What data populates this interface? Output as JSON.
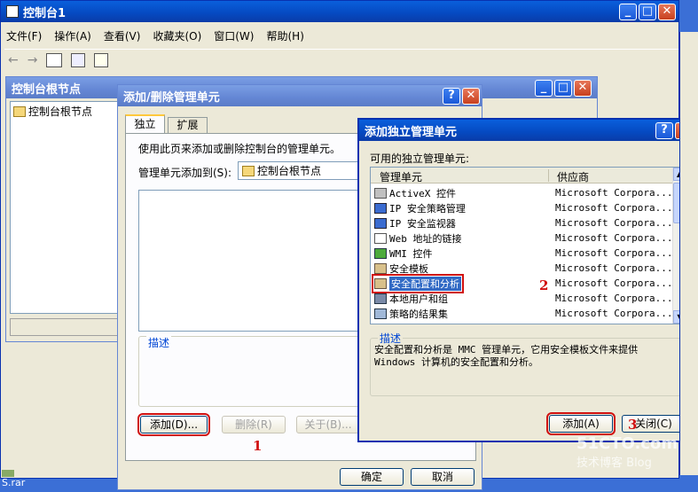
{
  "main_window": {
    "title": "控制台1",
    "menu": [
      "文件(F)",
      "操作(A)",
      "查看(V)",
      "收藏夹(O)",
      "窗口(W)",
      "帮助(H)"
    ]
  },
  "console_root": {
    "title": "控制台根节点",
    "tree_item": "控制台根节点"
  },
  "add_remove_dialog": {
    "title": "添加/删除管理单元",
    "tabs": [
      "独立",
      "扩展"
    ],
    "instruction": "使用此页来添加或删除控制台的管理单元。",
    "add_to_label": "管理单元添加到(S):",
    "add_to_value": "控制台根节点",
    "description_label": "描述",
    "buttons": {
      "add": "添加(D)...",
      "remove": "删除(R)",
      "about": "关于(B)..."
    },
    "ok": "确定",
    "cancel": "取消"
  },
  "standalone_dialog": {
    "title": "添加独立管理单元",
    "available_label": "可用的独立管理单元:",
    "columns": [
      "管理单元",
      "供应商"
    ],
    "items": [
      {
        "name": "ActiveX 控件",
        "vendor": "Microsoft Corpora..."
      },
      {
        "name": "IP 安全策略管理",
        "vendor": "Microsoft Corpora..."
      },
      {
        "name": "IP 安全监视器",
        "vendor": "Microsoft Corpora..."
      },
      {
        "name": "Web 地址的链接",
        "vendor": "Microsoft Corpora..."
      },
      {
        "name": "WMI 控件",
        "vendor": "Microsoft Corpora..."
      },
      {
        "name": "安全模板",
        "vendor": "Microsoft Corpora..."
      },
      {
        "name": "安全配置和分析",
        "vendor": "Microsoft Corpora..."
      },
      {
        "name": "本地用户和组",
        "vendor": "Microsoft Corpora..."
      },
      {
        "name": "策略的结果集",
        "vendor": "Microsoft Corpora..."
      }
    ],
    "description_label": "描述",
    "description_text": "安全配置和分析是 MMC 管理单元，它用安全模板文件来提供 Windows 计算机的安全配置和分析。",
    "buttons": {
      "add": "添加(A)",
      "close": "关闭(C)"
    }
  },
  "annotations": [
    "1",
    "2",
    "3"
  ],
  "watermark": {
    "line1": "51CTO.com",
    "line2": "技术博客",
    "line3": "Blog"
  },
  "desktop_file": "S.rar",
  "colors": {
    "title_active": "#0549c0",
    "dialog_bg": "#ece9d8",
    "annotation": "#d01010",
    "selection": "#316ac5"
  }
}
